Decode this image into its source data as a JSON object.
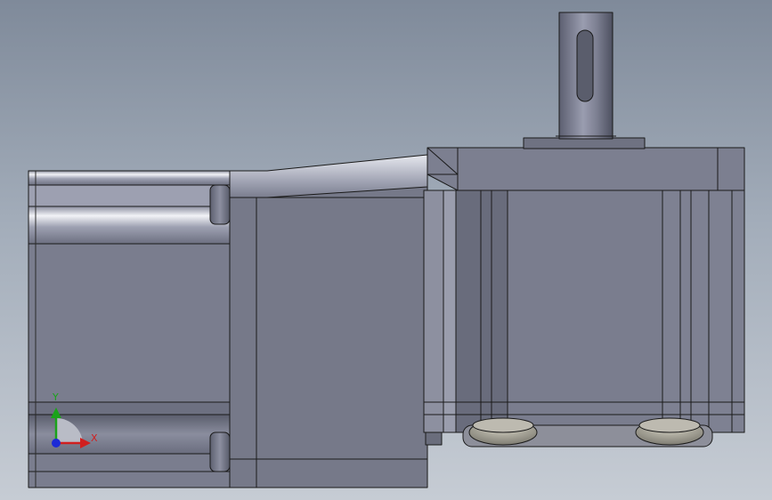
{
  "viewport": {
    "background_top": "#7f8a9a",
    "background_bottom": "#c6ccd4"
  },
  "triad": {
    "x_label": "X",
    "y_label": "Y",
    "x_color": "#d11f1f",
    "y_color": "#1aa31a",
    "z_color": "#1c2bd6"
  },
  "model": {
    "body_color": "#7a7d8e",
    "edge_color": "#1a1a1a",
    "highlight_color": "#e8eaf0"
  }
}
